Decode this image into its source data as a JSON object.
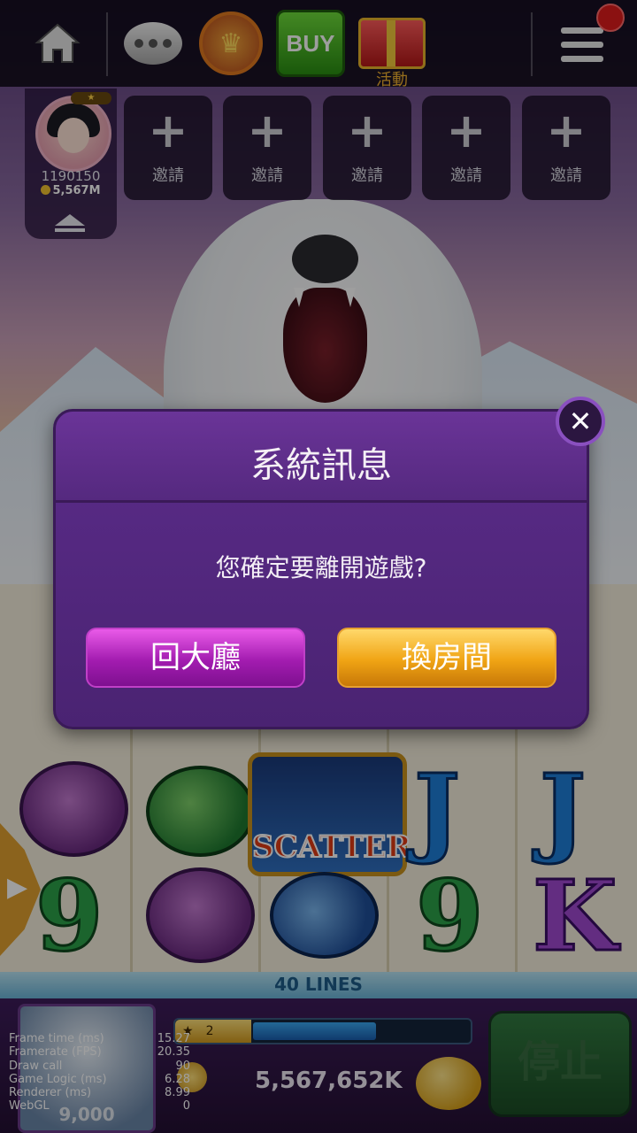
{
  "topbar": {
    "buy_label": "BUY",
    "gift_label": "活動",
    "icons": [
      "home-icon",
      "chat-icon",
      "crown-icon",
      "gift-icon",
      "menu-icon"
    ]
  },
  "player": {
    "id": "1190150",
    "coins": "5,567M"
  },
  "invites": [
    {
      "label": "邀請"
    },
    {
      "label": "邀請"
    },
    {
      "label": "邀請"
    },
    {
      "label": "邀請"
    },
    {
      "label": "邀請"
    }
  ],
  "dialog": {
    "title": "系統訊息",
    "message": "您確定要離開遊戲?",
    "lobby_button": "回大廳",
    "switch_room_button": "換房間"
  },
  "game": {
    "lines_label": "40 LINES",
    "scatter_label": "SCATTER"
  },
  "bottom": {
    "level": "2",
    "level_progress": 0.58,
    "balance": "5,567,652K",
    "thumb_price": "9,000",
    "stop_button": "停止"
  },
  "debug": {
    "rows": [
      {
        "label": "Frame time (ms)",
        "value": "15.27"
      },
      {
        "label": "Framerate (FPS)",
        "value": "20.35"
      },
      {
        "label": "Draw call",
        "value": "90"
      },
      {
        "label": "Game Logic (ms)",
        "value": "6.28"
      },
      {
        "label": "Renderer (ms)",
        "value": "8.99"
      },
      {
        "label": "WebGL",
        "value": "0"
      }
    ]
  },
  "colors": {
    "dialog_bg": "#5b2c8a",
    "lobby_button": "#a31cb0",
    "switch_room_button": "#f0a414",
    "notification": "#e01c1c"
  }
}
